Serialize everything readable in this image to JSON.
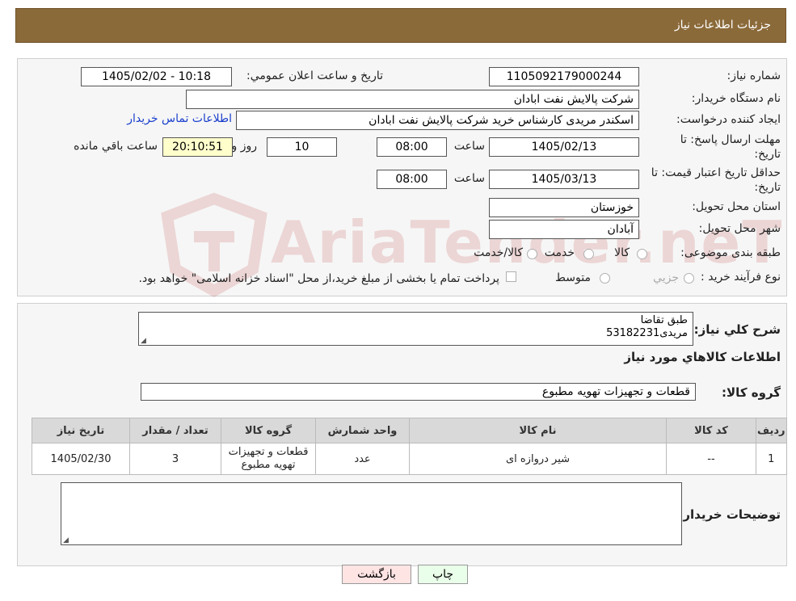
{
  "header": {
    "title": "جزئیات اطلاعات نیاز"
  },
  "form": {
    "need_number_label": "شماره نیاز:",
    "need_number": "1105092179000244",
    "announce_label": "تاریخ و ساعت اعلان عمومي:",
    "announce_value": "1405/02/02 - 10:18",
    "buyer_label": "نام دستگاه خریدار:",
    "buyer_value": "شرکت پالایش نفت ابادان",
    "creator_label": "ایجاد کننده درخواست:",
    "creator_value": "اسکندر مریدی کارشناس خرید شرکت پالایش نفت ابادان",
    "contact_link": "اطلاعات تماس خریدار",
    "deadline_label": "مهلت ارسال پاسخ: تا تاریخ:",
    "deadline_date": "1405/02/13",
    "time_label": "ساعت",
    "deadline_time": "08:00",
    "days_value": "10",
    "days_label": "روز و",
    "remaining_time": "20:10:51",
    "remaining_label": "ساعت باقي مانده",
    "validity_label": "حداقل تاریخ اعتبار قیمت: تا تاریخ:",
    "validity_date": "1405/03/13",
    "validity_time": "08:00",
    "province_label": "استان محل تحویل:",
    "province_value": "خوزستان",
    "city_label": "شهر محل تحویل:",
    "city_value": "آبادان",
    "category_label": "طبقه بندی موضوعی:",
    "category_options": [
      "کالا",
      "خدمت",
      "کالا/خدمت"
    ],
    "process_label": "نوع فرآیند خرید :",
    "process_options": [
      "جزیي",
      "متوسط"
    ],
    "process_note": "پرداخت تمام یا بخشی از مبلغ خرید،از محل \"اسناد خزانه اسلامی\" خواهد بود."
  },
  "description": {
    "label": "شرح کلي نياز:",
    "line1": "طبق تقاضا",
    "line2": "مریدی53182231"
  },
  "goods": {
    "section_title": "اطلاعات کالاهاي مورد نياز",
    "group_label": "گروه کالا:",
    "group_value": "قطعات و تجهیزات تهویه مطبوع",
    "columns": [
      "رديف",
      "کد کالا",
      "نام کالا",
      "واحد شمارش",
      "گروه کالا",
      "تعداد / مقدار",
      "تاريخ نياز"
    ],
    "rows": [
      {
        "index": "1",
        "code": "--",
        "name": "شیر دروازه ای",
        "unit": "عدد",
        "group": "قطعات و تجهیزات تهویه مطبوع",
        "qty": "3",
        "date": "1405/02/30"
      }
    ]
  },
  "buyer_notes": {
    "label": "توضیحات خریدار:"
  },
  "buttons": {
    "print": "چاپ",
    "back": "بازگشت"
  },
  "watermark": {
    "text": "AriaTender.neT"
  }
}
